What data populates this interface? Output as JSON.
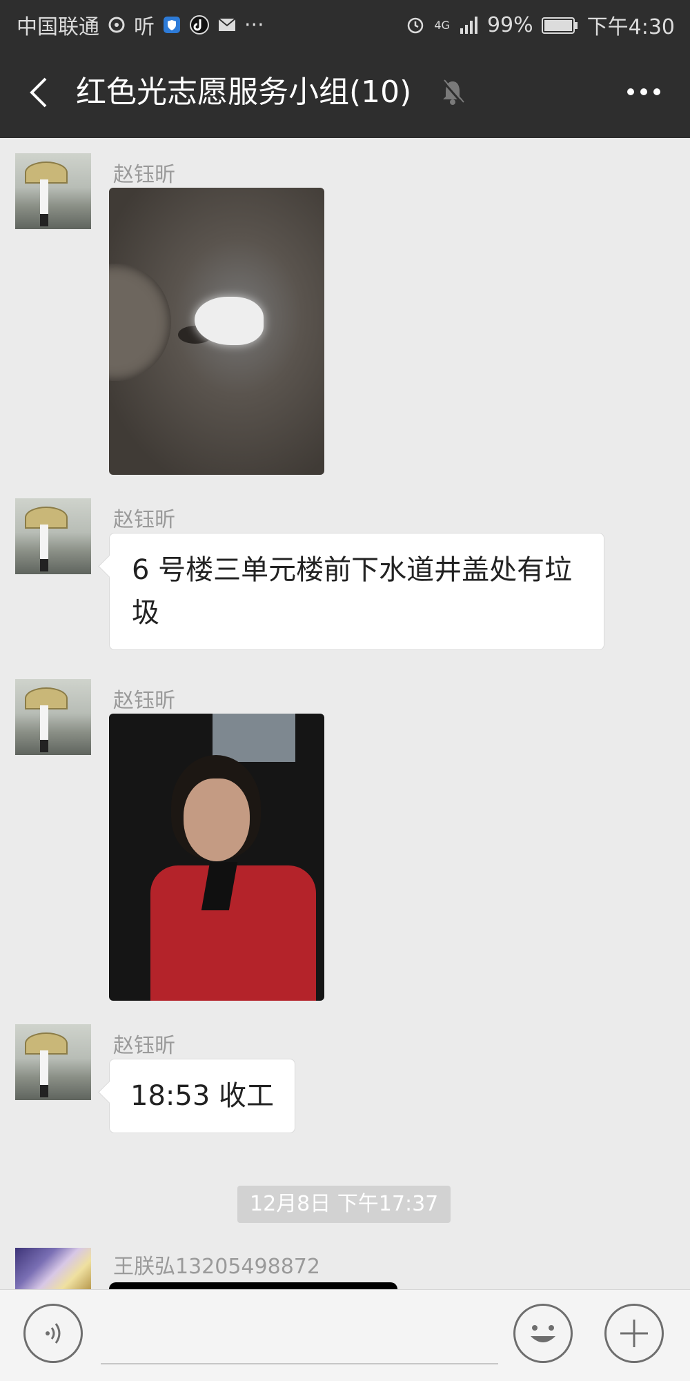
{
  "status_bar": {
    "carrier": "中国联通",
    "listen_label": "听",
    "more": "···",
    "network": "4G",
    "battery": "99%",
    "time": "下午4:30"
  },
  "header": {
    "title": "红色光志愿服务小组(10)",
    "icons": [
      "back-icon",
      "mute-bell-icon",
      "more-icon"
    ]
  },
  "messages": [
    {
      "sender": "赵钰昕",
      "type": "image",
      "description": ""
    },
    {
      "sender": "赵钰昕",
      "type": "text",
      "text": "6 号楼三单元楼前下水道井盖处有垃圾"
    },
    {
      "sender": "赵钰昕",
      "type": "image"
    },
    {
      "sender": "赵钰昕",
      "type": "text",
      "text": "18:53 收工"
    },
    {
      "type": "timestamp",
      "text": "12月8日 下午17:37"
    },
    {
      "sender": "王朕弘13205498872",
      "type": "image"
    }
  ],
  "input_bar": {
    "icons": [
      "voice-icon",
      "emoji-icon",
      "plus-icon"
    ],
    "input_value": ""
  },
  "colors": {
    "header_bg": "#2e2e2e",
    "chat_bg": "#ebebeb",
    "bubble_bg": "#ffffff",
    "timestamp_bg": "#d2d2d2"
  }
}
